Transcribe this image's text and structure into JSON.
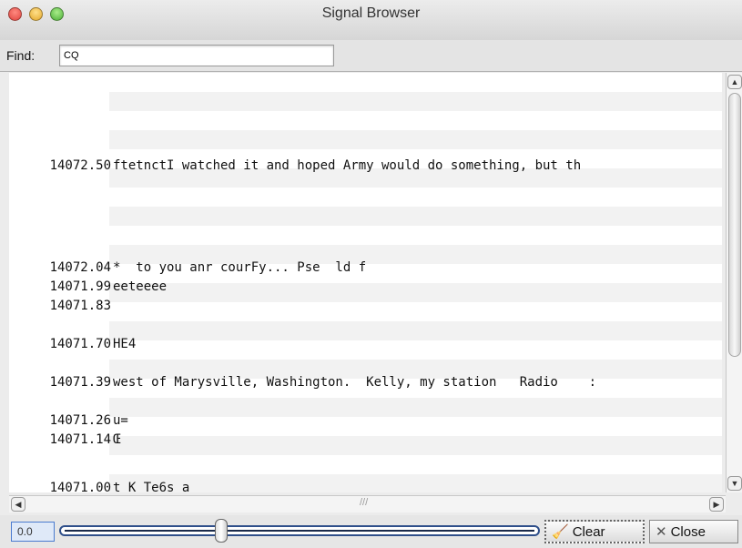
{
  "window": {
    "title": "Signal Browser"
  },
  "find": {
    "label": "Find:",
    "value": "CQ"
  },
  "rows": [
    {
      "freq": "14072.50",
      "text": "ftetnctI watched it and hoped Army would do something, but th"
    },
    {
      "freq": "14072.04",
      "text": "*  to you anr courFy... Pse  ld f"
    },
    {
      "freq": "14071.99",
      "text": "eeteeee"
    },
    {
      "freq": "14071.83",
      "text": ""
    },
    {
      "freq": "14071.70",
      "text": "HE4"
    },
    {
      "freq": "14071.39",
      "text": "west of Marysville, Washington.  Kelly, my station   Radio    :"
    },
    {
      "freq": "14071.26",
      "text": "u="
    },
    {
      "freq": "14071.14",
      "text": "Œ"
    },
    {
      "freq": "14071.00",
      "text": "t K Te6s a"
    }
  ],
  "slider": {
    "value_text": "0.0"
  },
  "buttons": {
    "clear": "Clear",
    "close": "Close"
  },
  "icons": {
    "clear": "broom-icon",
    "close": "close-x-icon"
  }
}
